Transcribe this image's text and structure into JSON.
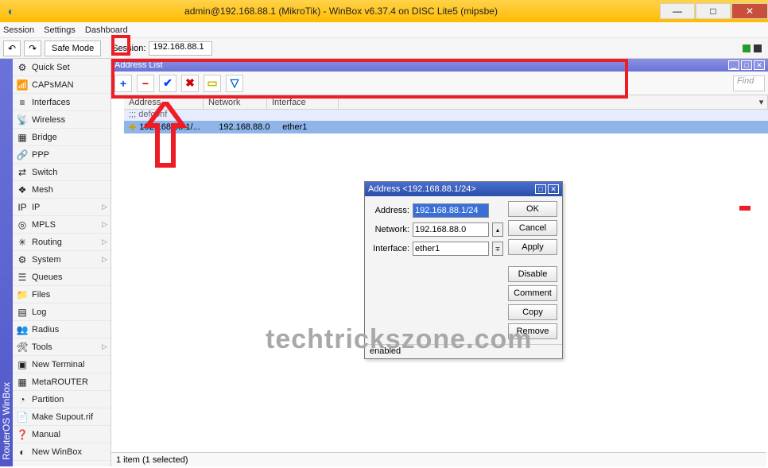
{
  "window": {
    "title": "admin@192.168.88.1 (MikroTik) - WinBox v6.37.4 on DISC Lite5 (mipsbe)"
  },
  "menubar": {
    "session": "Session",
    "settings": "Settings",
    "dashboard": "Dashboard"
  },
  "toolbar": {
    "safemode": "Safe Mode",
    "session_label": "Session:",
    "session_value": "192.168.88.1"
  },
  "sidetab": "RouterOS WinBox",
  "menu": {
    "items": [
      {
        "label": "Quick Set"
      },
      {
        "label": "CAPsMAN"
      },
      {
        "label": "Interfaces"
      },
      {
        "label": "Wireless"
      },
      {
        "label": "Bridge"
      },
      {
        "label": "PPP"
      },
      {
        "label": "Switch"
      },
      {
        "label": "Mesh"
      },
      {
        "label": "IP",
        "sub": true
      },
      {
        "label": "MPLS",
        "sub": true
      },
      {
        "label": "Routing",
        "sub": true
      },
      {
        "label": "System",
        "sub": true
      },
      {
        "label": "Queues"
      },
      {
        "label": "Files"
      },
      {
        "label": "Log"
      },
      {
        "label": "Radius"
      },
      {
        "label": "Tools",
        "sub": true
      },
      {
        "label": "New Terminal"
      },
      {
        "label": "MetaROUTER"
      },
      {
        "label": "Partition"
      },
      {
        "label": "Make Supout.rif"
      },
      {
        "label": "Manual"
      },
      {
        "label": "New WinBox"
      }
    ]
  },
  "addresslist": {
    "title": "Address List",
    "find_placeholder": "Find",
    "cols": {
      "c1": "Address",
      "c2": "Network",
      "c3": "Interface"
    },
    "defconf": ";;; defconf",
    "row": {
      "address": "192.168.88.1/...",
      "network": "192.168.88.0",
      "interface": "ether1"
    },
    "status": "1 item (1 selected)"
  },
  "dialog": {
    "title": "Address <192.168.88.1/24>",
    "address_label": "Address:",
    "address_value": "192.168.88.1/24",
    "network_label": "Network:",
    "network_value": "192.168.88.0",
    "interface_label": "Interface:",
    "interface_value": "ether1",
    "ok": "OK",
    "cancel": "Cancel",
    "apply": "Apply",
    "disable": "Disable",
    "comment": "Comment",
    "copy": "Copy",
    "remove": "Remove",
    "status": "enabled"
  },
  "watermark": "techtrickszone.com"
}
